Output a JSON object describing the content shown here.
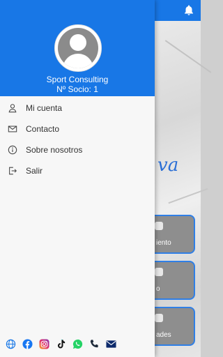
{
  "drawer": {
    "user_name": "Sport Consulting",
    "member_number": "Nº Socio: 1",
    "menu": [
      {
        "label": "Mi cuenta",
        "icon": "user-icon"
      },
      {
        "label": "Contacto",
        "icon": "envelope-icon"
      },
      {
        "label": "Sobre nosotros",
        "icon": "info-icon"
      },
      {
        "label": "Salir",
        "icon": "logout-icon"
      }
    ],
    "social_icons": [
      "globe-icon",
      "facebook-icon",
      "instagram-icon",
      "tiktok-icon",
      "whatsapp-icon",
      "phone-icon",
      "mail-icon"
    ]
  },
  "background": {
    "script_fragment": "va",
    "cards": [
      "iento",
      "o",
      "ades"
    ]
  },
  "colors": {
    "primary": "#1877e6",
    "drawer_bg": "#f7f7f7",
    "text": "#333333"
  }
}
